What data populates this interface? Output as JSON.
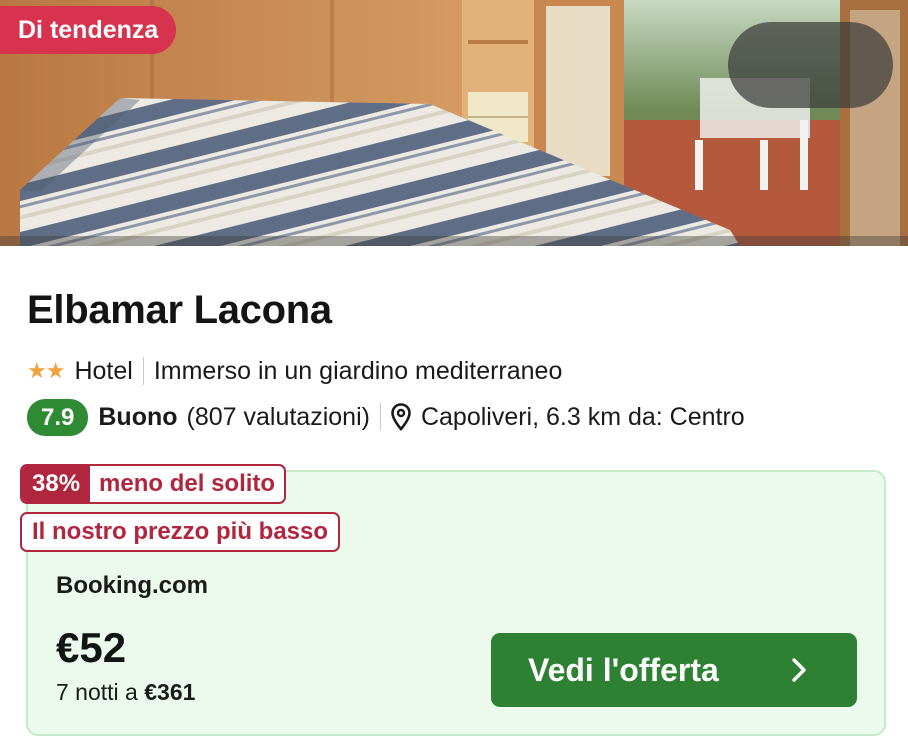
{
  "hero": {
    "badge": "Di tendenza",
    "actions": {
      "share_icon": "share-icon",
      "favorite_icon": "heart-outline-icon"
    }
  },
  "hotel": {
    "name": "Elbamar Lacona",
    "stars": 2,
    "stars_glyph": "★★",
    "type": "Hotel",
    "tagline": "Immerso in un giardino mediterraneo",
    "rating": {
      "score": "7.9",
      "label": "Buono",
      "reviews": "(807 valutazioni)"
    },
    "location": "Capoliveri, 6.3 km da: Centro"
  },
  "deal": {
    "percent": "38%",
    "percent_text": "meno del solito",
    "lowest_label": "Il nostro prezzo più basso",
    "provider": "Booking.com",
    "price": "€52",
    "nights_text": "7 notti a ",
    "total": "€361",
    "cta_label": "Vedi l'offerta"
  },
  "colors": {
    "trend_badge": "#d7324e",
    "score_badge": "#2f8a34",
    "deal_background": "#ebfaed",
    "discount": "#b0263f",
    "cta": "#2e8133",
    "stars": "#f0a23b"
  }
}
